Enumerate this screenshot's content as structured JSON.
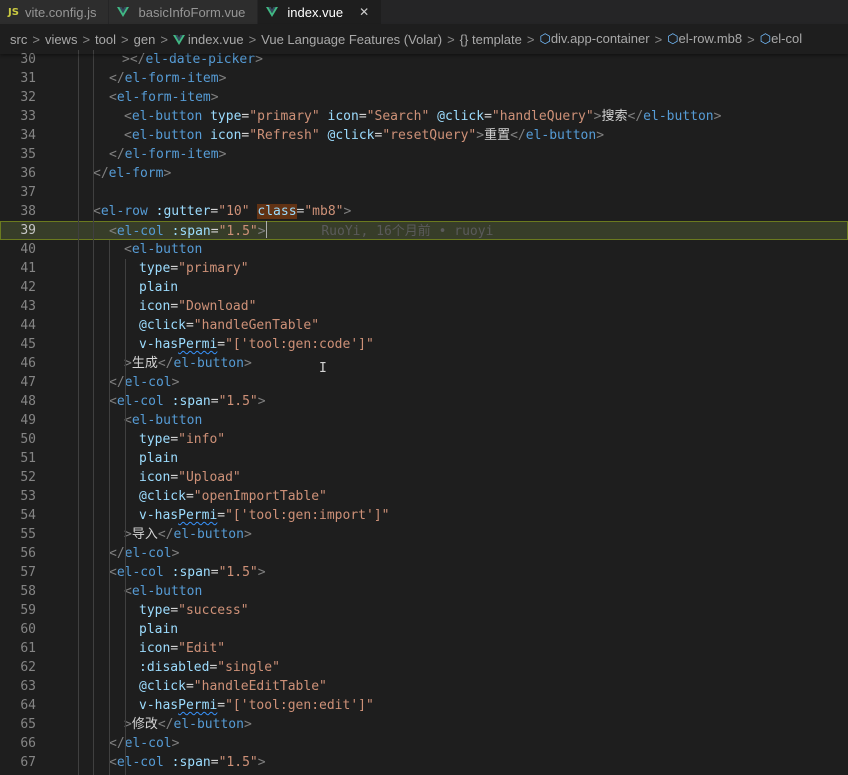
{
  "tabs": [
    {
      "icon": "JS",
      "label": "vite.config.js",
      "active": false
    },
    {
      "icon": "vue",
      "label": "basicInfoForm.vue",
      "active": false
    },
    {
      "icon": "vue",
      "label": "index.vue",
      "active": true,
      "close": "✕"
    }
  ],
  "breadcrumb": {
    "parts": [
      "src",
      "views",
      "tool",
      "gen",
      "index.vue",
      "Vue Language Features (Volar)",
      "template",
      "div.app-container",
      "el-row.mb8",
      "el-col"
    ],
    "braces": "{}",
    "separator": ">"
  },
  "colors": {
    "tag": "#569cd6",
    "attr": "#9cdcfe",
    "string": "#ce9178",
    "punct": "#808080",
    "text": "#d4d4d4",
    "vue_green": "#41b883",
    "current_line": "#373d29"
  },
  "code_lines": [
    {
      "n": "30",
      "parts": [
        [
          "t",
          ">"
        ],
        [
          "t",
          "</"
        ],
        [
          "tag",
          "el-date-picker"
        ],
        [
          "t",
          ">"
        ]
      ]
    },
    {
      "n": "31",
      "parts": [
        [
          "t",
          "</"
        ],
        [
          "tag",
          "el-form-item"
        ],
        [
          "t",
          ">"
        ]
      ]
    },
    {
      "n": "32",
      "parts": [
        [
          "t",
          "<"
        ],
        [
          "tag",
          "el-form-item"
        ],
        [
          "t",
          ">"
        ]
      ]
    },
    {
      "n": "33",
      "parts": [
        [
          "t",
          "<"
        ],
        [
          "tag",
          "el-button"
        ],
        [
          "txt",
          " "
        ],
        [
          "attr",
          "type"
        ],
        [
          "txt",
          "="
        ],
        [
          "str",
          "\"primary\""
        ],
        [
          "txt",
          " "
        ],
        [
          "attr",
          "icon"
        ],
        [
          "txt",
          "="
        ],
        [
          "str",
          "\"Search\""
        ],
        [
          "txt",
          " "
        ],
        [
          "attr",
          "@click"
        ],
        [
          "txt",
          "="
        ],
        [
          "str",
          "\"handleQuery\""
        ],
        [
          "t",
          ">"
        ],
        [
          "txt",
          "搜索"
        ],
        [
          "t",
          "</"
        ],
        [
          "tag",
          "el-button"
        ],
        [
          "t",
          ">"
        ]
      ]
    },
    {
      "n": "34",
      "parts": [
        [
          "t",
          "<"
        ],
        [
          "tag",
          "el-button"
        ],
        [
          "txt",
          " "
        ],
        [
          "attr",
          "icon"
        ],
        [
          "txt",
          "="
        ],
        [
          "str",
          "\"Refresh\""
        ],
        [
          "txt",
          " "
        ],
        [
          "attr",
          "@click"
        ],
        [
          "txt",
          "="
        ],
        [
          "str",
          "\"resetQuery\""
        ],
        [
          "t",
          ">"
        ],
        [
          "txt",
          "重置"
        ],
        [
          "t",
          "</"
        ],
        [
          "tag",
          "el-button"
        ],
        [
          "t",
          ">"
        ]
      ]
    },
    {
      "n": "35",
      "parts": [
        [
          "t",
          "</"
        ],
        [
          "tag",
          "el-form-item"
        ],
        [
          "t",
          ">"
        ]
      ]
    },
    {
      "n": "36",
      "parts": [
        [
          "t",
          "</"
        ],
        [
          "tag",
          "el-form"
        ],
        [
          "t",
          ">"
        ]
      ]
    },
    {
      "n": "37",
      "parts": []
    },
    {
      "n": "38",
      "parts": [
        [
          "t",
          "<"
        ],
        [
          "tag",
          "el-row"
        ],
        [
          "txt",
          " "
        ],
        [
          "attr",
          ":gutter"
        ],
        [
          "txt",
          "="
        ],
        [
          "str",
          "\"10\""
        ],
        [
          "txt",
          " "
        ],
        [
          "hl",
          "class"
        ],
        [
          "txt",
          "="
        ],
        [
          "str",
          "\"mb8\""
        ],
        [
          "t",
          ">"
        ]
      ]
    },
    {
      "n": "39",
      "parts": [
        [
          "t",
          "<"
        ],
        [
          "tag",
          "el-col"
        ],
        [
          "txt",
          " "
        ],
        [
          "attr",
          ":span"
        ],
        [
          "txt",
          "="
        ],
        [
          "str",
          "\"1.5\""
        ],
        [
          "t",
          ">"
        ],
        [
          "caret",
          ""
        ],
        [
          "blame",
          "       RuoYi, 16个月前 • ruoyi"
        ]
      ],
      "current": true
    },
    {
      "n": "40",
      "parts": [
        [
          "t",
          "<"
        ],
        [
          "tag",
          "el-button"
        ]
      ]
    },
    {
      "n": "41",
      "parts": [
        [
          "attr",
          "type"
        ],
        [
          "txt",
          "="
        ],
        [
          "str",
          "\"primary\""
        ]
      ]
    },
    {
      "n": "42",
      "parts": [
        [
          "attr",
          "plain"
        ]
      ]
    },
    {
      "n": "43",
      "parts": [
        [
          "attr",
          "icon"
        ],
        [
          "txt",
          "="
        ],
        [
          "str",
          "\"Download\""
        ]
      ]
    },
    {
      "n": "44",
      "parts": [
        [
          "attr",
          "@click"
        ],
        [
          "txt",
          "="
        ],
        [
          "str",
          "\"handleGenTable\""
        ]
      ]
    },
    {
      "n": "45",
      "parts": [
        [
          "attr",
          "v-has"
        ],
        [
          "squig",
          "Permi"
        ],
        [
          "txt",
          "="
        ],
        [
          "str",
          "\"['tool:gen:code']\""
        ]
      ]
    },
    {
      "n": "46",
      "parts": [
        [
          "t",
          ">"
        ],
        [
          "txt",
          "生成"
        ],
        [
          "t",
          "</"
        ],
        [
          "tag",
          "el-button"
        ],
        [
          "t",
          ">"
        ]
      ]
    },
    {
      "n": "47",
      "parts": [
        [
          "t",
          "</"
        ],
        [
          "tag",
          "el-col"
        ],
        [
          "t",
          ">"
        ]
      ]
    },
    {
      "n": "48",
      "parts": [
        [
          "t",
          "<"
        ],
        [
          "tag",
          "el-col"
        ],
        [
          "txt",
          " "
        ],
        [
          "attr",
          ":span"
        ],
        [
          "txt",
          "="
        ],
        [
          "str",
          "\"1.5\""
        ],
        [
          "t",
          ">"
        ]
      ]
    },
    {
      "n": "49",
      "parts": [
        [
          "t",
          "<"
        ],
        [
          "tag",
          "el-button"
        ]
      ]
    },
    {
      "n": "50",
      "parts": [
        [
          "attr",
          "type"
        ],
        [
          "txt",
          "="
        ],
        [
          "str",
          "\"info\""
        ]
      ]
    },
    {
      "n": "51",
      "parts": [
        [
          "attr",
          "plain"
        ]
      ]
    },
    {
      "n": "52",
      "parts": [
        [
          "attr",
          "icon"
        ],
        [
          "txt",
          "="
        ],
        [
          "str",
          "\"Upload\""
        ]
      ]
    },
    {
      "n": "53",
      "parts": [
        [
          "attr",
          "@click"
        ],
        [
          "txt",
          "="
        ],
        [
          "str",
          "\"openImportTable\""
        ]
      ]
    },
    {
      "n": "54",
      "parts": [
        [
          "attr",
          "v-has"
        ],
        [
          "squig",
          "Permi"
        ],
        [
          "txt",
          "="
        ],
        [
          "str",
          "\"['tool:gen:import']\""
        ]
      ]
    },
    {
      "n": "55",
      "parts": [
        [
          "t",
          ">"
        ],
        [
          "txt",
          "导入"
        ],
        [
          "t",
          "</"
        ],
        [
          "tag",
          "el-button"
        ],
        [
          "t",
          ">"
        ]
      ]
    },
    {
      "n": "56",
      "parts": [
        [
          "t",
          "</"
        ],
        [
          "tag",
          "el-col"
        ],
        [
          "t",
          ">"
        ]
      ]
    },
    {
      "n": "57",
      "parts": [
        [
          "t",
          "<"
        ],
        [
          "tag",
          "el-col"
        ],
        [
          "txt",
          " "
        ],
        [
          "attr",
          ":span"
        ],
        [
          "txt",
          "="
        ],
        [
          "str",
          "\"1.5\""
        ],
        [
          "t",
          ">"
        ]
      ]
    },
    {
      "n": "58",
      "parts": [
        [
          "t",
          "<"
        ],
        [
          "tag",
          "el-button"
        ]
      ]
    },
    {
      "n": "59",
      "parts": [
        [
          "attr",
          "type"
        ],
        [
          "txt",
          "="
        ],
        [
          "str",
          "\"success\""
        ]
      ]
    },
    {
      "n": "60",
      "parts": [
        [
          "attr",
          "plain"
        ]
      ]
    },
    {
      "n": "61",
      "parts": [
        [
          "attr",
          "icon"
        ],
        [
          "txt",
          "="
        ],
        [
          "str",
          "\"Edit\""
        ]
      ]
    },
    {
      "n": "62",
      "parts": [
        [
          "attr",
          ":disabled"
        ],
        [
          "txt",
          "="
        ],
        [
          "str",
          "\"single\""
        ]
      ]
    },
    {
      "n": "63",
      "parts": [
        [
          "attr",
          "@click"
        ],
        [
          "txt",
          "="
        ],
        [
          "str",
          "\"handleEditTable\""
        ]
      ]
    },
    {
      "n": "64",
      "parts": [
        [
          "attr",
          "v-has"
        ],
        [
          "squig",
          "Permi"
        ],
        [
          "txt",
          "="
        ],
        [
          "str",
          "\"['tool:gen:edit']\""
        ]
      ]
    },
    {
      "n": "65",
      "parts": [
        [
          "t",
          ">"
        ],
        [
          "txt",
          "修改"
        ],
        [
          "t",
          "</"
        ],
        [
          "tag",
          "el-button"
        ],
        [
          "t",
          ">"
        ]
      ]
    },
    {
      "n": "66",
      "parts": [
        [
          "t",
          "</"
        ],
        [
          "tag",
          "el-col"
        ],
        [
          "t",
          ">"
        ]
      ]
    },
    {
      "n": "67",
      "parts": [
        [
          "t",
          "<"
        ],
        [
          "tag",
          "el-col"
        ],
        [
          "txt",
          " "
        ],
        [
          "attr",
          ":span"
        ],
        [
          "txt",
          "="
        ],
        [
          "str",
          "\"1.5\""
        ],
        [
          "t",
          ">"
        ]
      ]
    }
  ]
}
